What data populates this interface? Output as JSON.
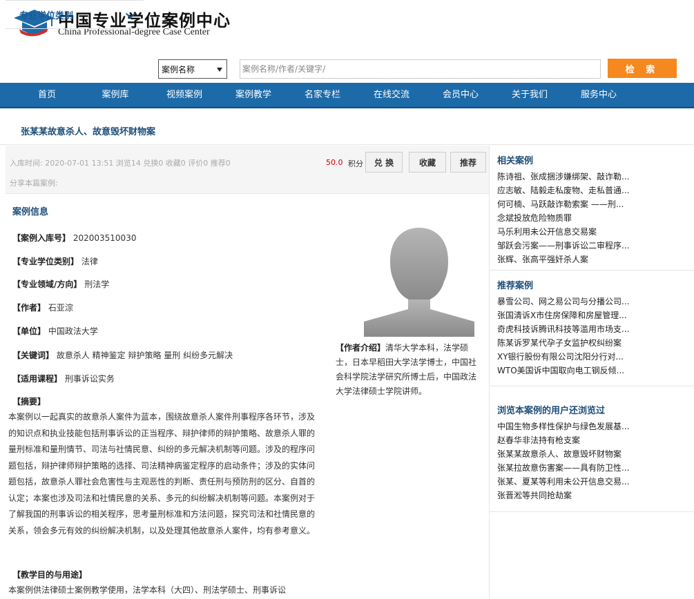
{
  "header": {
    "title_cn": "中国专业学位案例中心",
    "title_en": "China Professional-degree Case Center",
    "brand_color": "#1d6aa8",
    "logo_icon": "graduation-cap-icon"
  },
  "search": {
    "category_label": "专业学位类别",
    "field_selected": "案例名称",
    "placeholder": "案例名称/作者/关键字/",
    "button_label": "检 索"
  },
  "nav": {
    "items": [
      "首页",
      "案例库",
      "视频案例",
      "案例教学",
      "名家专栏",
      "在线交流",
      "会员中心",
      "关于我们",
      "服务中心"
    ]
  },
  "case": {
    "title": "张某某故意杀人、故意毁坏财物案",
    "meta": "入库时间: 2020-07-01 13:51   浏览14  兑换0  收藏0  评价0  推荐0",
    "share": "分享本篇案例:",
    "points_value": "50.0",
    "points_label": "积分",
    "buttons": {
      "exchange": "兑 换",
      "favorite": "收藏",
      "recommend": "推荐"
    },
    "info_heading": "案例信息",
    "fields": {
      "id_key": "【案例入库号】",
      "id_val": "202003510030",
      "degree_key": "【专业学位类别】",
      "degree_val": "法律",
      "domain_key": "【专业领域/方向】",
      "domain_val": "刑法学",
      "author_key": "【作者】",
      "author_val": "石亚淙",
      "unit_key": "【单位】",
      "unit_val": "中国政法大学",
      "keywords_key": "【关键词】",
      "keywords_val": "故意杀人 精神鉴定 辩护策略 量刑 纠纷多元解决",
      "course_key": "【适用课程】",
      "course_val": "刑事诉讼实务"
    },
    "abstract_heading": "【摘要】",
    "abstract": "本案例以一起真实的故意杀人案件为蓝本，围绕故意杀人案件刑事程序各环节，涉及的知识点和执业技能包括刑事诉讼的正当程序、辩护律师的辩护策略、故意杀人罪的量刑标准和量刑情节、司法与社情民意、纠纷的多元解决机制等问题。涉及的程序问题包括，辩护律师辩护策略的选择、司法精神病鉴定程序的启动条件；涉及的实体问题包括，故意杀人罪社会危害性与主观恶性的判断、责任刑与预防刑的区分、自首的认定；本案也涉及司法和社情民意的关系、多元的纠纷解决机制等问题。本案例对于了解我国的刑事诉讼的相关程序，思考量刑标准和方法问题，探究司法和社情民意的关系，领会多元有效的纠纷解决机制，以及处理其他故意杀人案件，均有参考意义。",
    "purpose_heading": "【教学目的与用途】",
    "purpose": "本案例供法律硕士案例教学使用，法学本科（大四）、刑法学硕士、刑事诉讼",
    "author_intro_key": "【作者介绍】",
    "author_intro": "清华大学本科，法学硕士，日本早稻田大学法学博士，中国社会科学院法学研究所博士后，中国政法大学法律硕士学院讲师。"
  },
  "sidebar": {
    "related_heading": "相关案例",
    "related": [
      "陈诗祖、张成捆涉嫌绑架、敲诈勒...",
      "应志敏、陆毅走私废物、走私普通...",
      "何可楠、马跃敲诈勒索案 ——刑...",
      "念斌投放危险物质罪",
      "马乐利用未公开信息交易案",
      "邹跃会污案——刑事诉讼二审程序...",
      "张辉、张高平强奸杀人案"
    ],
    "recommended_heading": "推荐案例",
    "recommended": [
      "暴雪公司、网之易公司与分播公司...",
      "张国清诉X市住房保障和房屋管理...",
      "奇虎科技诉腾讯科技等滥用市场支...",
      "陈某诉罗某代孕子女监护权纠纷案",
      "XY银行股份有限公司沈阳分行对...",
      "WTO美国诉中国取向电工钢反倾..."
    ],
    "also_viewed_heading": "浏览本案例的用户还浏览过",
    "also_viewed": [
      "中国生物多样性保护与绿色发展基...",
      "赵春华非法持有枪支案",
      "张某某故意杀人、故意毁坏财物案",
      "张某拉故意伤害案——具有防卫性...",
      "张某、夏某等利用未公开信息交易...",
      "张晋淞等共同抢劫案"
    ]
  }
}
